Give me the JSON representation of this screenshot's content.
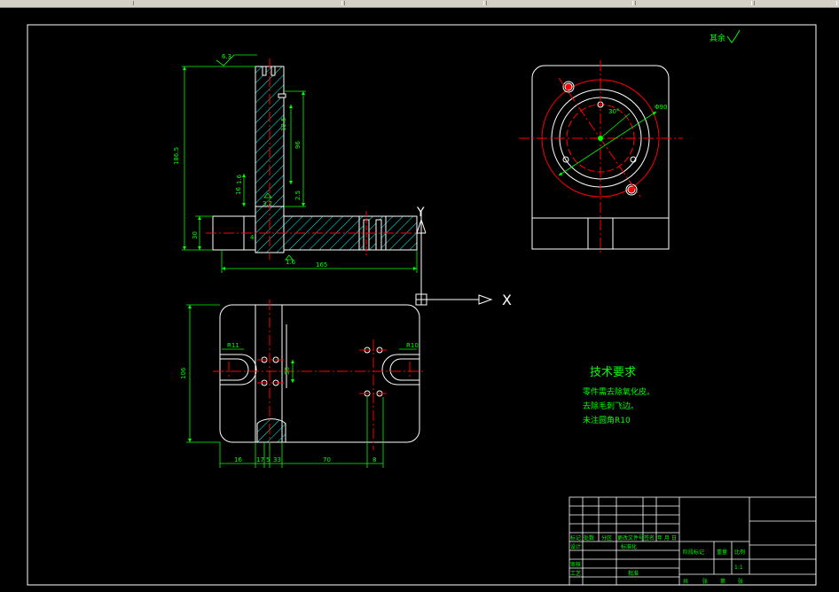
{
  "drawing": {
    "surface_roughness_note": "其余",
    "axis_y_label": "Y",
    "axis_x_label": "X",
    "tech_requirements": {
      "title": "技术要求",
      "items": [
        "零件需去除氧化皮。",
        "去除毛刺飞边。",
        "未注圆角R10"
      ]
    },
    "dimensions": {
      "roughness_top": "6.3",
      "overall_height": "186.5",
      "inner_height": "96",
      "slot_spacing": "12.5",
      "wall_thickness": "16",
      "small_height": "2.5",
      "roughness_mid": "3.2",
      "roughness_bottom": "1.6",
      "roughness_left": "1.6",
      "base_height": "30",
      "base_width": "165",
      "tick_small": "4",
      "plan_height": "106",
      "plan_left_radius": "R11",
      "plan_right_radius": "R10",
      "plan_vert": "30",
      "plan_w1": "16",
      "plan_w2": "17",
      "plan_w3": "5",
      "plan_w4": "33",
      "plan_w5": "70",
      "plan_w6": "8",
      "circle_dia": "Φ90",
      "angle": "30°"
    },
    "title_block": {
      "row_labels": [
        "标记",
        "处数",
        "分区",
        "更改文件号",
        "签名",
        "年 月 日"
      ],
      "design": "设计",
      "standardize": "标准化",
      "review": "审核",
      "process": "工艺",
      "approve": "批准",
      "stage_mark": "阶段标记",
      "weight": "重量",
      "scale": "比例",
      "scale_value": "1:1",
      "sheets": [
        "共",
        "张",
        "第",
        "张"
      ]
    }
  },
  "colors": {
    "outline": "#ffffff",
    "dimension": "#00ff00",
    "centerline": "#ff0000",
    "hatch": "#00ffff",
    "border": "#ffffff",
    "title_text": "#00ff00"
  }
}
